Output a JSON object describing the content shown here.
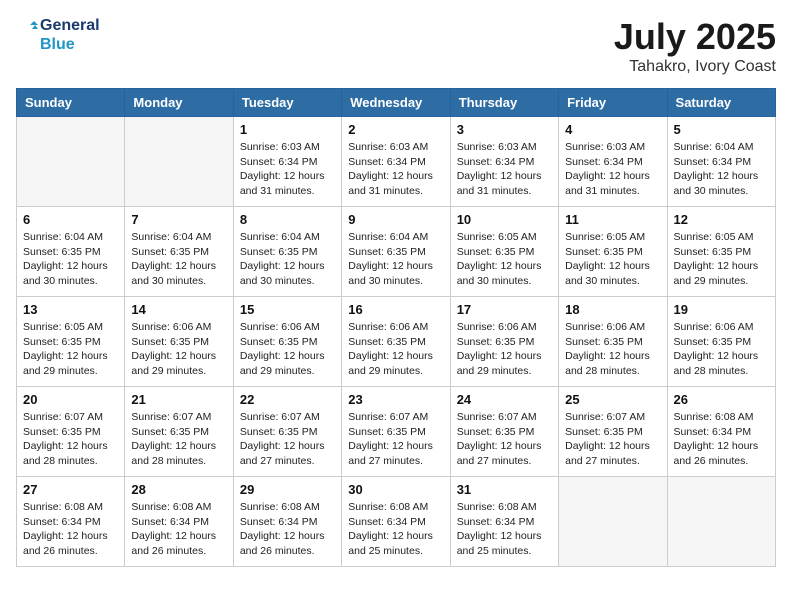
{
  "header": {
    "logo_line1": "General",
    "logo_line2": "Blue",
    "title": "July 2025",
    "subtitle": "Tahakro, Ivory Coast"
  },
  "weekdays": [
    "Sunday",
    "Monday",
    "Tuesday",
    "Wednesday",
    "Thursday",
    "Friday",
    "Saturday"
  ],
  "weeks": [
    [
      {
        "day": "",
        "info": ""
      },
      {
        "day": "",
        "info": ""
      },
      {
        "day": "1",
        "info": "Sunrise: 6:03 AM\nSunset: 6:34 PM\nDaylight: 12 hours\nand 31 minutes."
      },
      {
        "day": "2",
        "info": "Sunrise: 6:03 AM\nSunset: 6:34 PM\nDaylight: 12 hours\nand 31 minutes."
      },
      {
        "day": "3",
        "info": "Sunrise: 6:03 AM\nSunset: 6:34 PM\nDaylight: 12 hours\nand 31 minutes."
      },
      {
        "day": "4",
        "info": "Sunrise: 6:03 AM\nSunset: 6:34 PM\nDaylight: 12 hours\nand 31 minutes."
      },
      {
        "day": "5",
        "info": "Sunrise: 6:04 AM\nSunset: 6:34 PM\nDaylight: 12 hours\nand 30 minutes."
      }
    ],
    [
      {
        "day": "6",
        "info": "Sunrise: 6:04 AM\nSunset: 6:35 PM\nDaylight: 12 hours\nand 30 minutes."
      },
      {
        "day": "7",
        "info": "Sunrise: 6:04 AM\nSunset: 6:35 PM\nDaylight: 12 hours\nand 30 minutes."
      },
      {
        "day": "8",
        "info": "Sunrise: 6:04 AM\nSunset: 6:35 PM\nDaylight: 12 hours\nand 30 minutes."
      },
      {
        "day": "9",
        "info": "Sunrise: 6:04 AM\nSunset: 6:35 PM\nDaylight: 12 hours\nand 30 minutes."
      },
      {
        "day": "10",
        "info": "Sunrise: 6:05 AM\nSunset: 6:35 PM\nDaylight: 12 hours\nand 30 minutes."
      },
      {
        "day": "11",
        "info": "Sunrise: 6:05 AM\nSunset: 6:35 PM\nDaylight: 12 hours\nand 30 minutes."
      },
      {
        "day": "12",
        "info": "Sunrise: 6:05 AM\nSunset: 6:35 PM\nDaylight: 12 hours\nand 29 minutes."
      }
    ],
    [
      {
        "day": "13",
        "info": "Sunrise: 6:05 AM\nSunset: 6:35 PM\nDaylight: 12 hours\nand 29 minutes."
      },
      {
        "day": "14",
        "info": "Sunrise: 6:06 AM\nSunset: 6:35 PM\nDaylight: 12 hours\nand 29 minutes."
      },
      {
        "day": "15",
        "info": "Sunrise: 6:06 AM\nSunset: 6:35 PM\nDaylight: 12 hours\nand 29 minutes."
      },
      {
        "day": "16",
        "info": "Sunrise: 6:06 AM\nSunset: 6:35 PM\nDaylight: 12 hours\nand 29 minutes."
      },
      {
        "day": "17",
        "info": "Sunrise: 6:06 AM\nSunset: 6:35 PM\nDaylight: 12 hours\nand 29 minutes."
      },
      {
        "day": "18",
        "info": "Sunrise: 6:06 AM\nSunset: 6:35 PM\nDaylight: 12 hours\nand 28 minutes."
      },
      {
        "day": "19",
        "info": "Sunrise: 6:06 AM\nSunset: 6:35 PM\nDaylight: 12 hours\nand 28 minutes."
      }
    ],
    [
      {
        "day": "20",
        "info": "Sunrise: 6:07 AM\nSunset: 6:35 PM\nDaylight: 12 hours\nand 28 minutes."
      },
      {
        "day": "21",
        "info": "Sunrise: 6:07 AM\nSunset: 6:35 PM\nDaylight: 12 hours\nand 28 minutes."
      },
      {
        "day": "22",
        "info": "Sunrise: 6:07 AM\nSunset: 6:35 PM\nDaylight: 12 hours\nand 27 minutes."
      },
      {
        "day": "23",
        "info": "Sunrise: 6:07 AM\nSunset: 6:35 PM\nDaylight: 12 hours\nand 27 minutes."
      },
      {
        "day": "24",
        "info": "Sunrise: 6:07 AM\nSunset: 6:35 PM\nDaylight: 12 hours\nand 27 minutes."
      },
      {
        "day": "25",
        "info": "Sunrise: 6:07 AM\nSunset: 6:35 PM\nDaylight: 12 hours\nand 27 minutes."
      },
      {
        "day": "26",
        "info": "Sunrise: 6:08 AM\nSunset: 6:34 PM\nDaylight: 12 hours\nand 26 minutes."
      }
    ],
    [
      {
        "day": "27",
        "info": "Sunrise: 6:08 AM\nSunset: 6:34 PM\nDaylight: 12 hours\nand 26 minutes."
      },
      {
        "day": "28",
        "info": "Sunrise: 6:08 AM\nSunset: 6:34 PM\nDaylight: 12 hours\nand 26 minutes."
      },
      {
        "day": "29",
        "info": "Sunrise: 6:08 AM\nSunset: 6:34 PM\nDaylight: 12 hours\nand 26 minutes."
      },
      {
        "day": "30",
        "info": "Sunrise: 6:08 AM\nSunset: 6:34 PM\nDaylight: 12 hours\nand 25 minutes."
      },
      {
        "day": "31",
        "info": "Sunrise: 6:08 AM\nSunset: 6:34 PM\nDaylight: 12 hours\nand 25 minutes."
      },
      {
        "day": "",
        "info": ""
      },
      {
        "day": "",
        "info": ""
      }
    ]
  ]
}
